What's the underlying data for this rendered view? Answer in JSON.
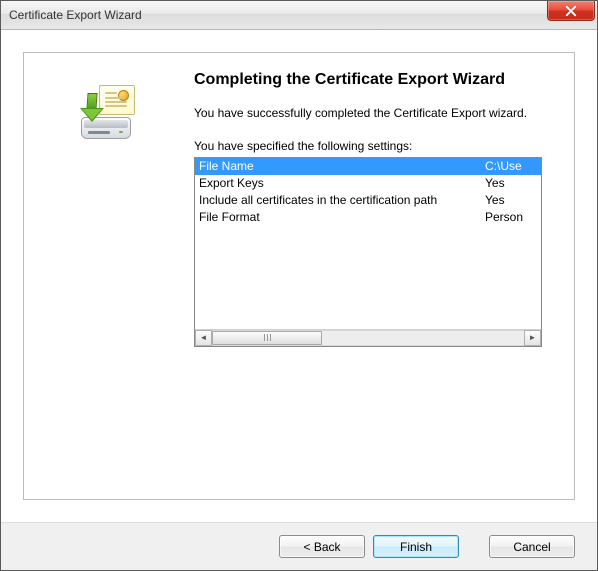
{
  "window": {
    "title": "Certificate Export Wizard"
  },
  "main": {
    "heading": "Completing the Certificate Export Wizard",
    "success_text": "You have successfully completed the Certificate Export wizard.",
    "settings_label": "You have specified the following settings:",
    "rows": [
      {
        "name": "File Name",
        "value": "C:\\Use"
      },
      {
        "name": "Export Keys",
        "value": "Yes"
      },
      {
        "name": "Include all certificates in the certification path",
        "value": "Yes"
      },
      {
        "name": "File Format",
        "value": "Person"
      }
    ]
  },
  "buttons": {
    "back": "< Back",
    "finish": "Finish",
    "cancel": "Cancel"
  }
}
